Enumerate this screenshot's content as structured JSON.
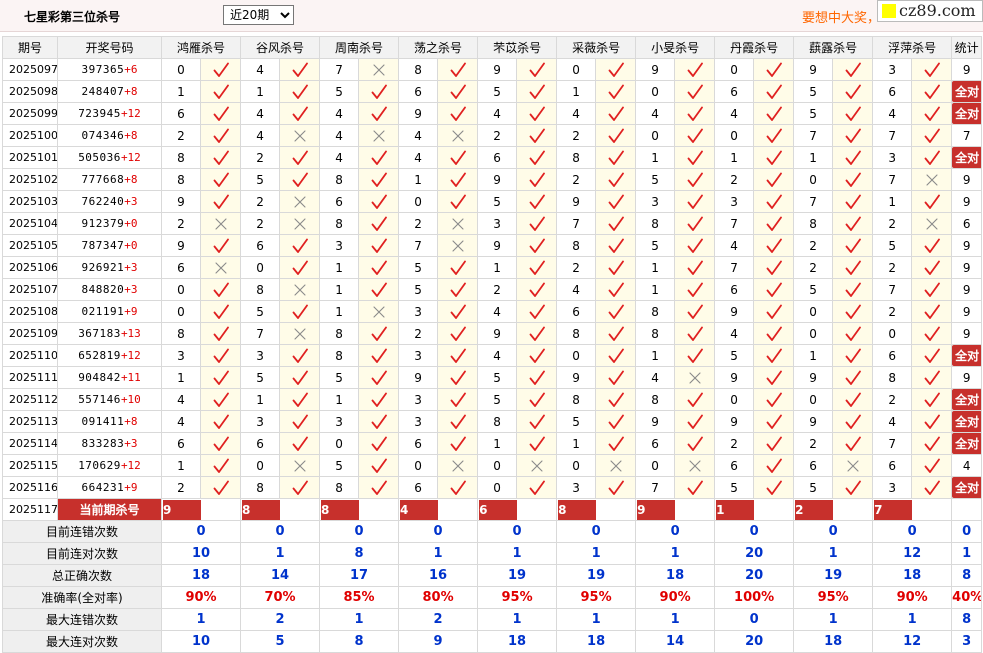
{
  "title": "七星彩第三位杀号",
  "period_select": {
    "selected": "近20期",
    "options": [
      "近20期"
    ]
  },
  "promo_text": "要想中大奖，",
  "watermark": "cz89.com",
  "all_right_label": "全对",
  "headers": [
    "期号",
    "开奖号码",
    "鸿雁杀号",
    "谷风杀号",
    "周南杀号",
    "荡之杀号",
    "芣苡杀号",
    "采薇杀号",
    "小旻杀号",
    "丹霞杀号",
    "蕻露杀号",
    "浮萍杀号",
    "统计"
  ],
  "rows": [
    {
      "issue": "2025097",
      "digits": "397365",
      "sum": "+6",
      "kills": [
        0,
        4,
        7,
        8,
        9,
        0,
        9,
        0,
        9,
        3
      ],
      "hits": [
        1,
        1,
        0,
        1,
        1,
        1,
        1,
        1,
        1,
        1
      ],
      "stat": "9"
    },
    {
      "issue": "2025098",
      "digits": "248407",
      "sum": "+8",
      "kills": [
        1,
        1,
        5,
        6,
        5,
        1,
        0,
        6,
        5,
        6
      ],
      "hits": [
        1,
        1,
        1,
        1,
        1,
        1,
        1,
        1,
        1,
        1
      ],
      "stat": "全对"
    },
    {
      "issue": "2025099",
      "digits": "723945",
      "sum": "+12",
      "kills": [
        6,
        4,
        4,
        9,
        4,
        4,
        4,
        4,
        5,
        4
      ],
      "hits": [
        1,
        1,
        1,
        1,
        1,
        1,
        1,
        1,
        1,
        1
      ],
      "stat": "全对"
    },
    {
      "issue": "2025100",
      "digits": "074346",
      "sum": "+8",
      "kills": [
        2,
        4,
        4,
        4,
        2,
        2,
        0,
        0,
        7,
        7
      ],
      "hits": [
        1,
        0,
        0,
        0,
        1,
        1,
        1,
        1,
        1,
        1
      ],
      "stat": "7"
    },
    {
      "issue": "2025101",
      "digits": "505036",
      "sum": "+12",
      "kills": [
        8,
        2,
        4,
        4,
        6,
        8,
        1,
        1,
        1,
        3
      ],
      "hits": [
        1,
        1,
        1,
        1,
        1,
        1,
        1,
        1,
        1,
        1
      ],
      "stat": "全对"
    },
    {
      "issue": "2025102",
      "digits": "777668",
      "sum": "+8",
      "kills": [
        8,
        5,
        8,
        1,
        9,
        2,
        5,
        2,
        0,
        7
      ],
      "hits": [
        1,
        1,
        1,
        1,
        1,
        1,
        1,
        1,
        1,
        0
      ],
      "stat": "9"
    },
    {
      "issue": "2025103",
      "digits": "762240",
      "sum": "+3",
      "kills": [
        9,
        2,
        6,
        0,
        5,
        9,
        3,
        3,
        7,
        1
      ],
      "hits": [
        1,
        0,
        1,
        1,
        1,
        1,
        1,
        1,
        1,
        1
      ],
      "stat": "9"
    },
    {
      "issue": "2025104",
      "digits": "912379",
      "sum": "+0",
      "kills": [
        2,
        2,
        8,
        2,
        3,
        7,
        8,
        7,
        8,
        2
      ],
      "hits": [
        0,
        0,
        1,
        0,
        1,
        1,
        1,
        1,
        1,
        0
      ],
      "stat": "6"
    },
    {
      "issue": "2025105",
      "digits": "787347",
      "sum": "+0",
      "kills": [
        9,
        6,
        3,
        7,
        9,
        8,
        5,
        4,
        2,
        5
      ],
      "hits": [
        1,
        1,
        1,
        0,
        1,
        1,
        1,
        1,
        1,
        1
      ],
      "stat": "9"
    },
    {
      "issue": "2025106",
      "digits": "926921",
      "sum": "+3",
      "kills": [
        6,
        0,
        1,
        5,
        1,
        2,
        1,
        7,
        2,
        2
      ],
      "hits": [
        0,
        1,
        1,
        1,
        1,
        1,
        1,
        1,
        1,
        1
      ],
      "stat": "9"
    },
    {
      "issue": "2025107",
      "digits": "848820",
      "sum": "+3",
      "kills": [
        0,
        8,
        1,
        5,
        2,
        4,
        1,
        6,
        5,
        7
      ],
      "hits": [
        1,
        0,
        1,
        1,
        1,
        1,
        1,
        1,
        1,
        1
      ],
      "stat": "9"
    },
    {
      "issue": "2025108",
      "digits": "021191",
      "sum": "+9",
      "kills": [
        0,
        5,
        1,
        3,
        4,
        6,
        8,
        9,
        0,
        2
      ],
      "hits": [
        1,
        1,
        0,
        1,
        1,
        1,
        1,
        1,
        1,
        1
      ],
      "stat": "9"
    },
    {
      "issue": "2025109",
      "digits": "367183",
      "sum": "+13",
      "kills": [
        8,
        7,
        8,
        2,
        9,
        8,
        8,
        4,
        0,
        0
      ],
      "hits": [
        1,
        0,
        1,
        1,
        1,
        1,
        1,
        1,
        1,
        1
      ],
      "stat": "9"
    },
    {
      "issue": "2025110",
      "digits": "652819",
      "sum": "+12",
      "kills": [
        3,
        3,
        8,
        3,
        4,
        0,
        1,
        5,
        1,
        6
      ],
      "hits": [
        1,
        1,
        1,
        1,
        1,
        1,
        1,
        1,
        1,
        1
      ],
      "stat": "全对"
    },
    {
      "issue": "2025111",
      "digits": "904842",
      "sum": "+11",
      "kills": [
        1,
        5,
        5,
        9,
        5,
        9,
        4,
        9,
        9,
        8
      ],
      "hits": [
        1,
        1,
        1,
        1,
        1,
        1,
        0,
        1,
        1,
        1
      ],
      "stat": "9"
    },
    {
      "issue": "2025112",
      "digits": "557146",
      "sum": "+10",
      "kills": [
        4,
        1,
        1,
        3,
        5,
        8,
        8,
        0,
        0,
        2
      ],
      "hits": [
        1,
        1,
        1,
        1,
        1,
        1,
        1,
        1,
        1,
        1
      ],
      "stat": "全对"
    },
    {
      "issue": "2025113",
      "digits": "091411",
      "sum": "+8",
      "kills": [
        4,
        3,
        3,
        3,
        8,
        5,
        9,
        9,
        9,
        4
      ],
      "hits": [
        1,
        1,
        1,
        1,
        1,
        1,
        1,
        1,
        1,
        1
      ],
      "stat": "全对"
    },
    {
      "issue": "2025114",
      "digits": "833283",
      "sum": "+3",
      "kills": [
        6,
        6,
        0,
        6,
        1,
        1,
        6,
        2,
        2,
        7
      ],
      "hits": [
        1,
        1,
        1,
        1,
        1,
        1,
        1,
        1,
        1,
        1
      ],
      "stat": "全对"
    },
    {
      "issue": "2025115",
      "digits": "170629",
      "sum": "+12",
      "kills": [
        1,
        0,
        5,
        0,
        0,
        0,
        0,
        6,
        6,
        6
      ],
      "hits": [
        1,
        0,
        1,
        0,
        0,
        0,
        0,
        1,
        0,
        1
      ],
      "stat": "4"
    },
    {
      "issue": "2025116",
      "digits": "664231",
      "sum": "+9",
      "kills": [
        2,
        8,
        8,
        6,
        0,
        3,
        7,
        5,
        5,
        3
      ],
      "hits": [
        1,
        1,
        1,
        1,
        1,
        1,
        1,
        1,
        1,
        1
      ],
      "stat": "全对"
    }
  ],
  "current": {
    "issue": "2025117",
    "label": "当前期杀号",
    "kills": [
      "9",
      "8",
      "8",
      "4",
      "6",
      "8",
      "9",
      "1",
      "2",
      "7"
    ]
  },
  "stats": [
    {
      "label": "目前连错次数",
      "values": [
        "0",
        "0",
        "0",
        "0",
        "0",
        "0",
        "0",
        "0",
        "0",
        "0",
        "0"
      ]
    },
    {
      "label": "目前连对次数",
      "values": [
        "10",
        "1",
        "8",
        "1",
        "1",
        "1",
        "1",
        "20",
        "1",
        "12",
        "1"
      ]
    },
    {
      "label": "总正确次数",
      "values": [
        "18",
        "14",
        "17",
        "16",
        "19",
        "19",
        "18",
        "20",
        "19",
        "18",
        "8"
      ]
    },
    {
      "label": "准确率(全对率)",
      "values": [
        "90%",
        "70%",
        "85%",
        "80%",
        "95%",
        "95%",
        "90%",
        "100%",
        "95%",
        "90%",
        "40%"
      ]
    },
    {
      "label": "最大连错次数",
      "values": [
        "1",
        "2",
        "1",
        "2",
        "1",
        "1",
        "1",
        "0",
        "1",
        "1",
        "8"
      ]
    },
    {
      "label": "最大连对次数",
      "values": [
        "10",
        "5",
        "8",
        "9",
        "18",
        "18",
        "14",
        "20",
        "18",
        "12",
        "3"
      ]
    }
  ]
}
